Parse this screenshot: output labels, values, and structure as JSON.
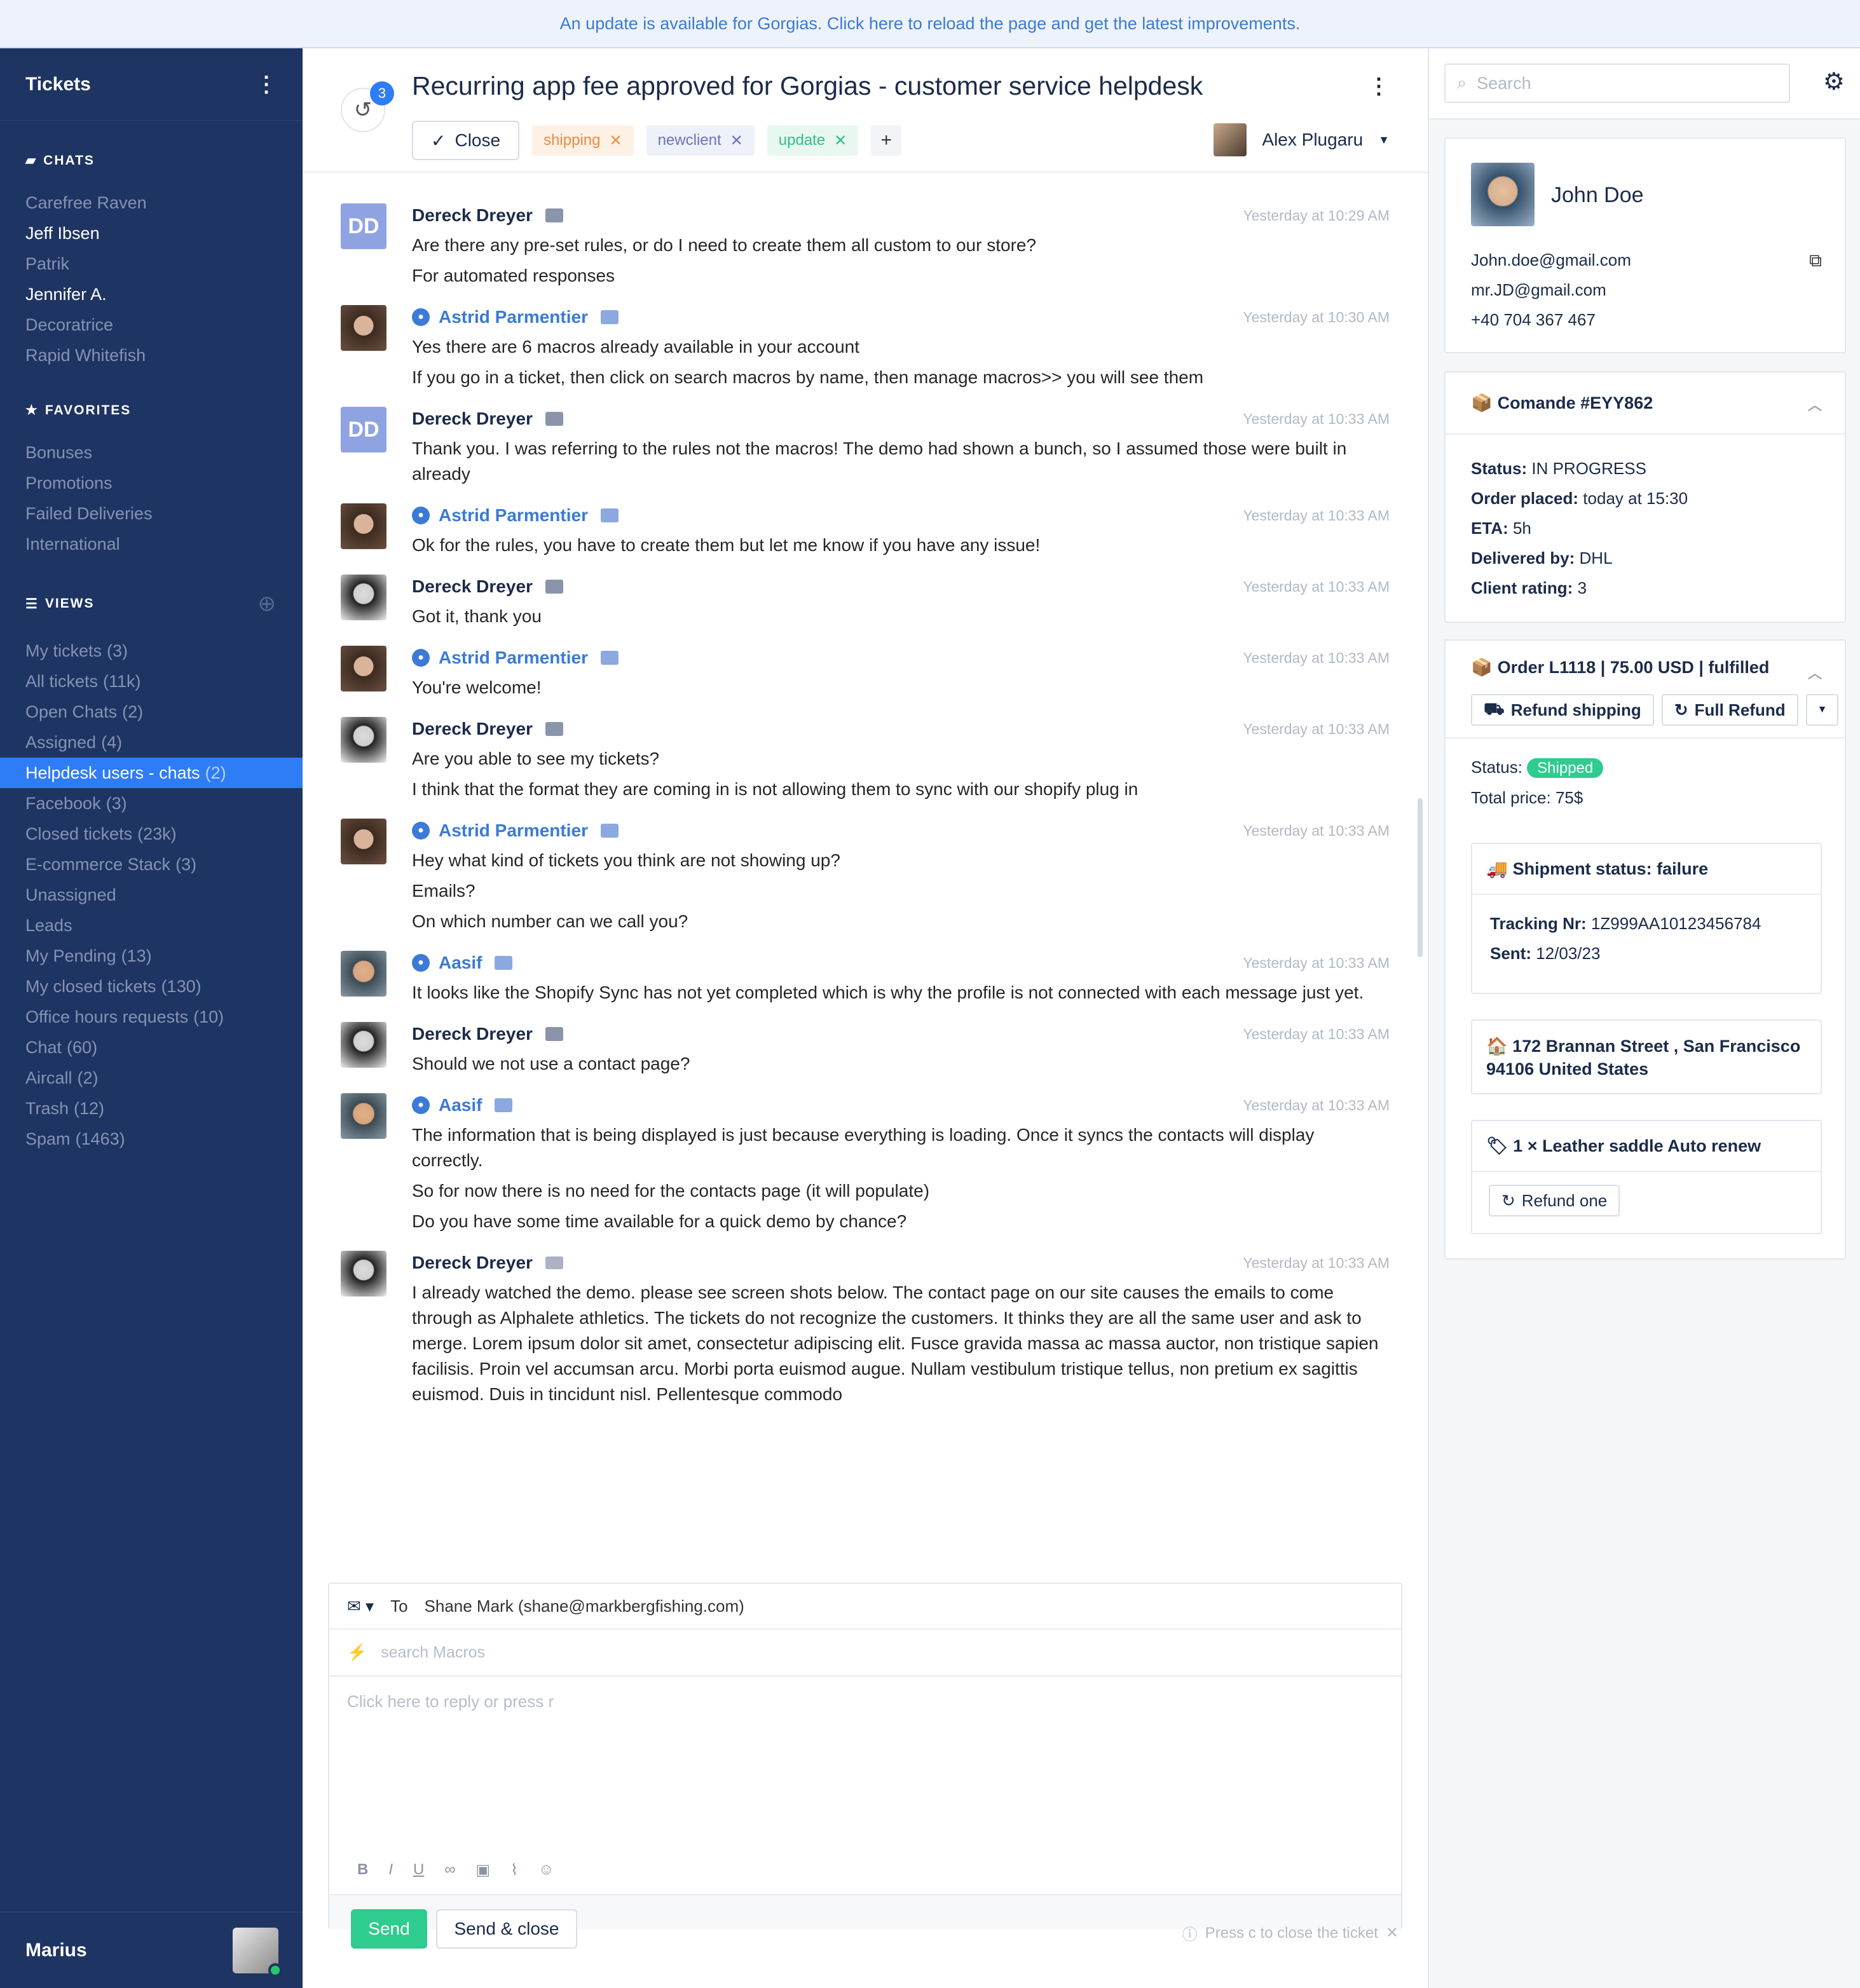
{
  "banner": {
    "text": "An update is available for Gorgias. Click here to reload the page and get the latest improvements."
  },
  "sidebar": {
    "title": "Tickets",
    "chats_label": "CHATS",
    "chats": [
      {
        "label": "Carefree Raven",
        "bright": false
      },
      {
        "label": "Jeff Ibsen",
        "bright": true
      },
      {
        "label": "Patrik",
        "bright": false
      },
      {
        "label": "Jennifer A.",
        "bright": true
      },
      {
        "label": "Decoratrice",
        "bright": false
      },
      {
        "label": "Rapid Whitefish",
        "bright": false
      }
    ],
    "favorites_label": "FAVORITES",
    "favorites": [
      "Bonuses",
      "Promotions",
      "Failed Deliveries",
      "International"
    ],
    "views_label": "VIEWS",
    "views": [
      {
        "label": "My tickets",
        "count": "(3)"
      },
      {
        "label": "All tickets",
        "count": "(11k)"
      },
      {
        "label": "Open Chats",
        "count": "(2)"
      },
      {
        "label": "Assigned",
        "count": "(4)"
      },
      {
        "label": "Helpdesk users - chats",
        "count": "(2)",
        "active": true
      },
      {
        "label": "Facebook",
        "count": "(3)"
      },
      {
        "label": "Closed tickets",
        "count": "(23k)"
      },
      {
        "label": "E-commerce Stack",
        "count": "(3)"
      },
      {
        "label": "Unassigned",
        "count": ""
      },
      {
        "label": "Leads",
        "count": ""
      },
      {
        "label": "My Pending",
        "count": "(13)"
      },
      {
        "label": "My closed tickets",
        "count": "(130)"
      },
      {
        "label": "Office hours requests",
        "count": "(10)"
      },
      {
        "label": "Chat",
        "count": "(60)"
      },
      {
        "label": "Aircall",
        "count": "(2)"
      },
      {
        "label": "Trash",
        "count": "(12)"
      },
      {
        "label": "Spam",
        "count": "(1463)"
      }
    ],
    "user": "Marius"
  },
  "ticket": {
    "history_count": "3",
    "title": "Recurring app fee approved for Gorgias - customer service helpdesk",
    "close_label": "Close",
    "tags": [
      {
        "label": "shipping",
        "color": "orange"
      },
      {
        "label": "newclient",
        "color": "purple"
      },
      {
        "label": "update",
        "color": "green"
      }
    ],
    "add_tag": "+",
    "assignee": "Alex Plugaru"
  },
  "messages": [
    {
      "author": "Dereck Dreyer",
      "avatar": "dd",
      "initials": "DD",
      "agent": false,
      "channel": "chat",
      "time": "Yesterday at 10:29 AM",
      "lines": [
        "Are there any pre-set rules, or do I need to create them all custom to our store?",
        "For automated responses"
      ]
    },
    {
      "author": "Astrid Parmentier",
      "avatar": "woman",
      "agent": true,
      "channel": "chat",
      "time": "Yesterday at 10:30 AM",
      "lines": [
        "Yes there are 6 macros already available in your account",
        "If you go in a ticket, then click on search macros by name, then manage macros>> you will see them"
      ]
    },
    {
      "author": "Dereck Dreyer",
      "avatar": "dd",
      "initials": "DD",
      "agent": false,
      "channel": "chat",
      "time": "Yesterday at 10:33 AM",
      "lines": [
        "Thank you. I was referring to the rules not the macros! The demo had shown a bunch, so I assumed those were built in already"
      ]
    },
    {
      "author": "Astrid Parmentier",
      "avatar": "woman",
      "agent": true,
      "channel": "chat",
      "time": "Yesterday at 10:33 AM",
      "lines": [
        "Ok for the rules, you have to create them but let me know if you have any issue!"
      ]
    },
    {
      "author": "Dereck Dreyer",
      "avatar": "man",
      "agent": false,
      "channel": "chat",
      "time": "Yesterday at 10:33 AM",
      "lines": [
        "Got it, thank you"
      ]
    },
    {
      "author": "Astrid Parmentier",
      "avatar": "woman",
      "agent": true,
      "channel": "chat",
      "time": "Yesterday at 10:33 AM",
      "lines": [
        "You're welcome!"
      ]
    },
    {
      "author": "Dereck Dreyer",
      "avatar": "man",
      "agent": false,
      "channel": "chat",
      "time": "Yesterday at 10:33 AM",
      "lines": [
        "Are you able to see my tickets?",
        "I think that the format they are coming in is not allowing them to sync with our shopify plug in"
      ]
    },
    {
      "author": "Astrid Parmentier",
      "avatar": "woman",
      "agent": true,
      "channel": "chat",
      "time": "Yesterday at 10:33 AM",
      "lines": [
        "Hey what kind of tickets you think are not showing up?",
        "Emails?",
        "On which number can we call you?"
      ]
    },
    {
      "author": "Aasif",
      "avatar": "aasif",
      "agent": true,
      "channel": "chat",
      "time": "Yesterday at 10:33 AM",
      "lines": [
        "It looks like the Shopify Sync has not yet completed which is why the profile is not connected with each message just yet."
      ]
    },
    {
      "author": "Dereck Dreyer",
      "avatar": "man",
      "agent": false,
      "channel": "chat",
      "time": "Yesterday at 10:33 AM",
      "lines": [
        "Should we not use a contact page?"
      ]
    },
    {
      "author": "Aasif",
      "avatar": "aasif",
      "agent": true,
      "channel": "chat",
      "time": "Yesterday at 10:33 AM",
      "lines": [
        "The information that is being displayed is just because everything is loading. Once it syncs the contacts will display correctly.",
        "So for now there is no need for the contacts page (it will populate)",
        "Do you have some time available for a quick demo by chance?"
      ]
    },
    {
      "author": "Dereck Dreyer",
      "avatar": "man",
      "agent": false,
      "channel": "email",
      "time": "Yesterday at 10:33 AM",
      "lines": [
        "I already watched the demo. please see screen shots below. The contact page on our site causes the emails to come through as Alphalete athletics. The tickets do not recognize the customers. It thinks they are all the same user and ask to merge.  Lorem ipsum dolor sit amet, consectetur adipiscing elit. Fusce gravida massa ac massa auctor, non tristique sapien facilisis. Proin vel accumsan arcu. Morbi porta euismod augue. Nullam vestibulum tristique tellus, non pretium ex sagittis euismod. Duis in tincidunt nisl. Pellentesque commodo"
      ]
    }
  ],
  "composer": {
    "to_label": "To",
    "to_value": "Shane Mark (shane@markbergfishing.com)",
    "macros_placeholder": "search Macros",
    "body_placeholder": "Click here to reply or press r",
    "send": "Send",
    "send_close": "Send & close",
    "hint": "Press c to close the ticket"
  },
  "right": {
    "search_placeholder": "Search",
    "customer": {
      "name": "John Doe",
      "email1": "John.doe@gmail.com",
      "email2": "mr.JD@gmail.com",
      "phone": "+40 704 367 467"
    },
    "order1": {
      "title": "Comande #EYY862",
      "status_k": "Status:",
      "status_v": "IN PROGRESS",
      "placed_k": "Order placed:",
      "placed_v": "today at 15:30",
      "eta_k": "ETA:",
      "eta_v": "5h",
      "deliv_k": "Delivered by:",
      "deliv_v": "DHL",
      "rating_k": "Client rating:",
      "rating_v": "3"
    },
    "order2": {
      "title": "Order L1118 | 75.00 USD | fulfilled",
      "refund_shipping": "Refund shipping",
      "full_refund": "Full Refund",
      "status_k": "Status:",
      "status_v": "Shipped",
      "total": "Total price: 75$",
      "shipment_title": "Shipment status: failure",
      "tracking_k": "Tracking Nr:",
      "tracking_v": "1Z999AA10123456784",
      "sent_k": "Sent:",
      "sent_v": "12/03/23",
      "address": "172 Brannan Street , San Francisco 94106 United States",
      "item": "1 × Leather saddle Auto renew",
      "refund_one": "Refund one"
    }
  }
}
